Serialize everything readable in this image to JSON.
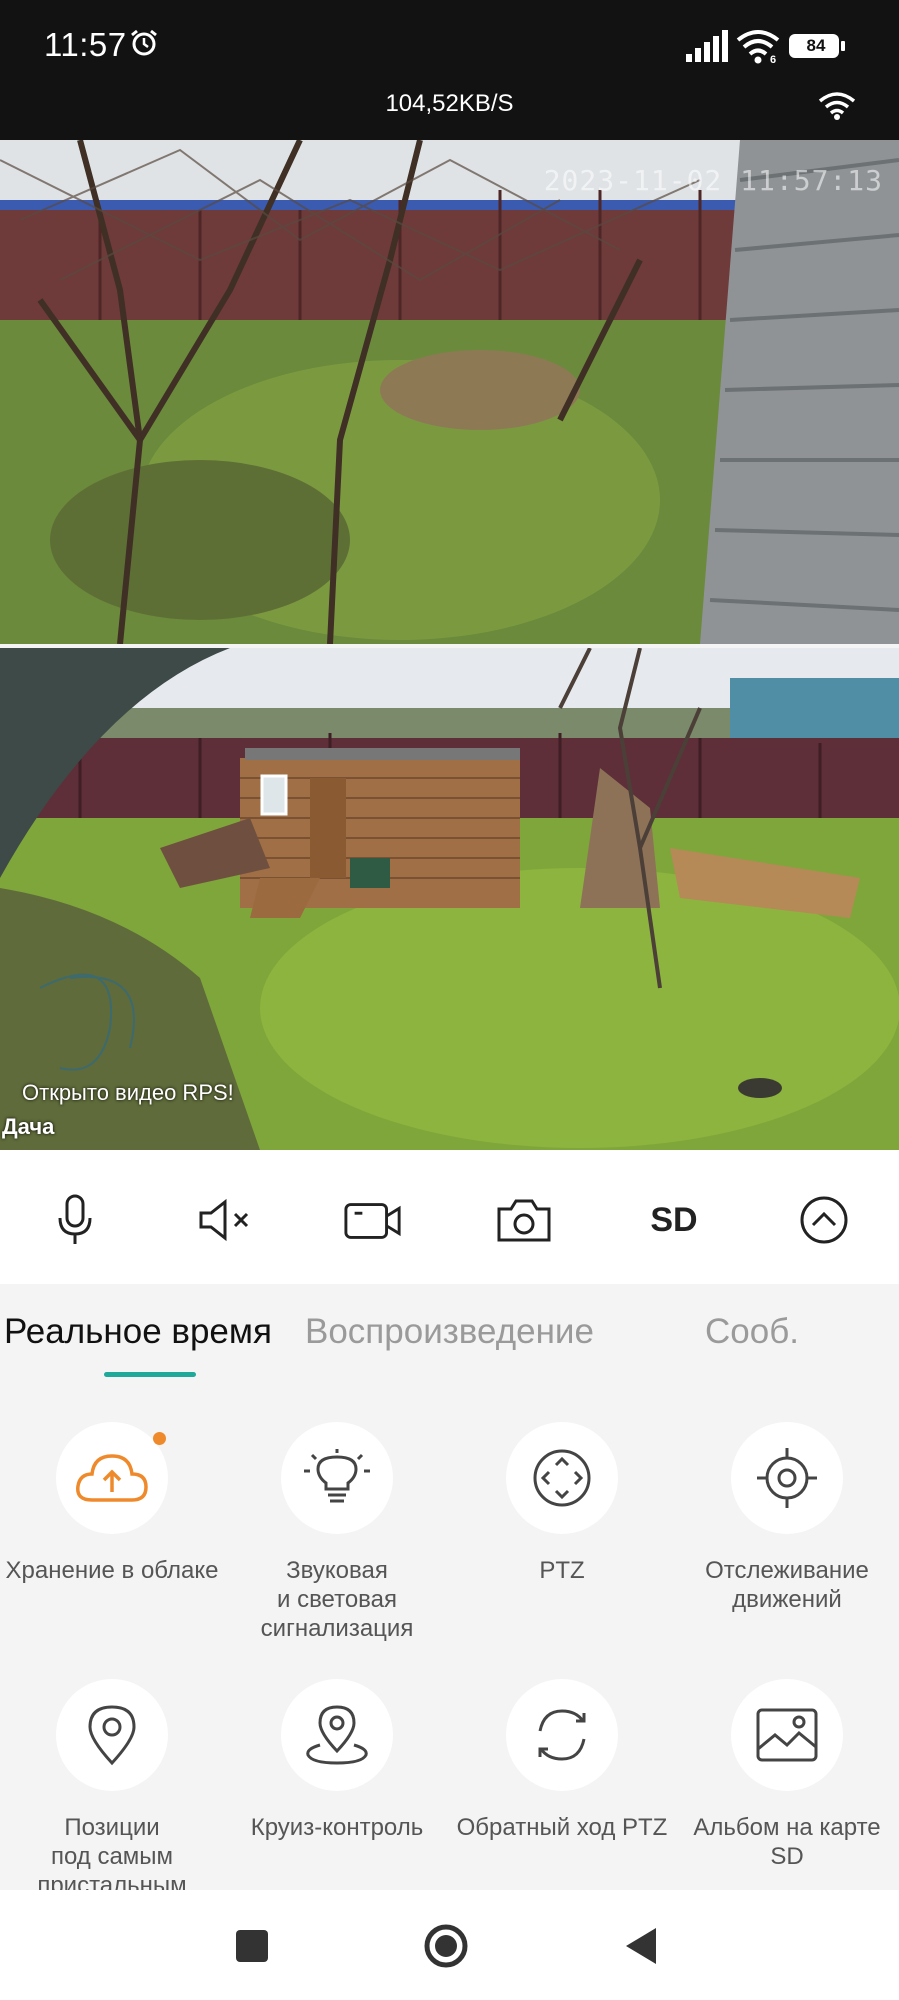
{
  "status_bar": {
    "time": "11:57",
    "battery": "84",
    "network_speed": "104,52KB/S"
  },
  "camera": {
    "osd_timestamp": "2023-11-02 11:57:13",
    "notice": "Открыто видео RPS!",
    "device_name": "Дача"
  },
  "toolbar": {
    "items": [
      "microphone-icon",
      "mute-icon",
      "record-video-icon",
      "snapshot-camera-icon",
      "quality",
      "expand-up-icon"
    ],
    "quality_label": "SD"
  },
  "tabs": {
    "items": [
      {
        "label": "Реальное время",
        "active": true
      },
      {
        "label": "Воспроизведение",
        "active": false
      },
      {
        "label": "Сооб.",
        "active": false
      }
    ],
    "accent": "#1fa99b"
  },
  "features": [
    {
      "label": "Хранение в облаке",
      "icon": "cloud-upload-icon",
      "badge": true
    },
    {
      "label": "Звуковая\nи световая\nсигнализация",
      "icon": "alarm-light-icon"
    },
    {
      "label": "PTZ",
      "icon": "ptz-icon"
    },
    {
      "label": "Отслеживание\nдвижений",
      "icon": "motion-tracking-icon"
    },
    {
      "label": "Позиции\nпод самым\nпристальным",
      "icon": "location-pin-icon"
    },
    {
      "label": "Круиз-контроль",
      "icon": "cruise-control-icon"
    },
    {
      "label": "Обратный ход PTZ",
      "icon": "reverse-ptz-icon"
    },
    {
      "label": "Альбом на карте\nSD",
      "icon": "sd-album-icon"
    }
  ],
  "colors": {
    "badge": "#ef8a2c",
    "cloud_icon": "#ef8a2c",
    "status_bar": "#121212"
  },
  "navbar": [
    "recent-apps-icon",
    "home-icon",
    "back-icon"
  ]
}
